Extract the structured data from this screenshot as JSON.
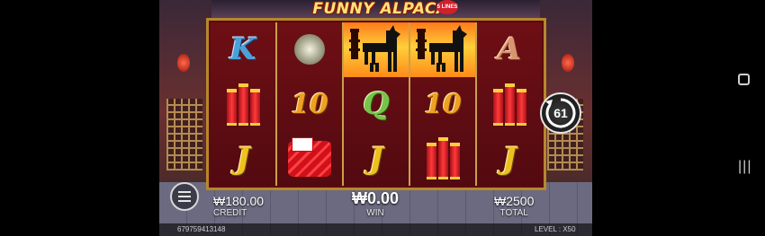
{
  "game": {
    "title": "FUNNY ALPACA",
    "title_badge": "5 LINES"
  },
  "reels": [
    [
      "K",
      "gong",
      "J"
    ],
    [
      "gong",
      "10",
      "firecracker-bundle"
    ],
    [
      "alpaca",
      "Q",
      "J"
    ],
    [
      "alpaca",
      "10",
      "firecrackers"
    ],
    [
      "A",
      "firecrackers",
      "J"
    ]
  ],
  "symbols_text": {
    "k": "K",
    "a": "A",
    "q": "Q",
    "j": "J",
    "ten": "10"
  },
  "spin": {
    "count": "61"
  },
  "credit": {
    "value": "₩180.00",
    "label": "CREDIT"
  },
  "win": {
    "value": "₩0.00",
    "label": "WIN"
  },
  "total": {
    "value": "₩2500",
    "label": "TOTAL"
  },
  "footer": {
    "game_id": "679759413148",
    "level_label": "LEVEL :",
    "level_value": "X50"
  },
  "icons": {
    "menu": "hamburger-icon",
    "spin": "autospin-icon",
    "nav_home": "square-icon",
    "nav_recent": "recent-apps-icon"
  },
  "colors": {
    "frame": "#b8872c",
    "reel_bg": "#6e0f15",
    "title": "#ffe27a"
  }
}
